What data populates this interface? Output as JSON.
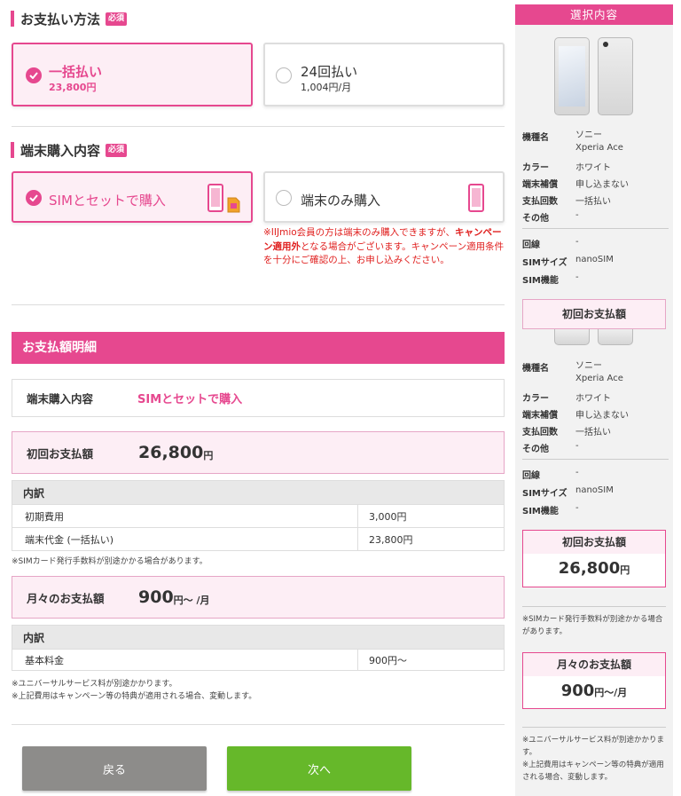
{
  "payment": {
    "title": "お支払い方法",
    "required": "必須",
    "options": [
      {
        "main": "一括払い",
        "sub": "23,800円",
        "selected": true
      },
      {
        "main": "24回払い",
        "sub": "1,004円/月",
        "selected": false
      }
    ]
  },
  "purchase": {
    "title": "端末購入内容",
    "required": "必須",
    "options": [
      {
        "main": "SIMとセットで購入",
        "selected": true
      },
      {
        "main": "端末のみ購入",
        "selected": false
      }
    ],
    "warning_before": "※IIJmio会員の方は端末のみ購入できますが、",
    "warning_bold": "キャンペーン適用外",
    "warning_after": "となる場合がございます。キャンペーン適用条件を十分にご確認の上、お申し込みください。"
  },
  "detail": {
    "header": "お支払額明細",
    "purchase_label": "端末購入内容",
    "purchase_value": "SIMとセットで購入",
    "initial_label": "初回お支払額",
    "initial_amount": "26,800",
    "yen": "円",
    "breakdown_label": "内訳",
    "initial_rows": [
      {
        "name": "初期費用",
        "value": "3,000円"
      },
      {
        "name": "端末代金 (一括払い)",
        "value": "23,800円"
      }
    ],
    "sim_note": "※SIMカード発行手数料が別途かかる場合があります。",
    "monthly_label": "月々のお支払額",
    "monthly_amount": "900",
    "monthly_unit": "円～ /月",
    "monthly_rows": [
      {
        "name": "基本料金",
        "value": "900円～"
      }
    ],
    "notes": [
      "※ユニバーサルサービス料が別途かかります。",
      "※上記費用はキャンペーン等の特典が適用される場合、変動します。"
    ]
  },
  "buttons": {
    "back": "戻る",
    "next": "次へ"
  },
  "sidebar": {
    "title": "選択内容",
    "spec1": [
      {
        "label": "機種名",
        "value": "ソニー",
        "value2": "Xperia Ace"
      },
      {
        "label": "カラー",
        "value": "ホワイト"
      },
      {
        "label": "端末補償",
        "value": "申し込まない"
      },
      {
        "label": "支払回数",
        "value": "一括払い"
      },
      {
        "label": "その他",
        "value": "-"
      }
    ],
    "spec1b": [
      {
        "label": "回線",
        "value": "-"
      },
      {
        "label": "SIMサイズ",
        "value": "nanoSIM"
      },
      {
        "label": "SIM機能",
        "value": "-"
      }
    ],
    "floating_label": "初回お支払額",
    "spec2": [
      {
        "label": "機種名",
        "value": "ソニー",
        "value2": "Xperia Ace"
      },
      {
        "label": "カラー",
        "value": "ホワイト"
      },
      {
        "label": "端末補償",
        "value": "申し込まない"
      },
      {
        "label": "支払回数",
        "value": "一括払い"
      },
      {
        "label": "その他",
        "value": "-"
      }
    ],
    "spec2b": [
      {
        "label": "回線",
        "value": "-"
      },
      {
        "label": "SIMサイズ",
        "value": "nanoSIM"
      },
      {
        "label": "SIM機能",
        "value": "-"
      }
    ],
    "initial_label": "初回お支払額",
    "initial_amount": "26,800",
    "yen": "円",
    "sim_note": "※SIMカード発行手数料が別途かかる場合があります。",
    "monthly_label": "月々のお支払額",
    "monthly_amount": "900",
    "monthly_unit": "円～/月",
    "notes": [
      "※ユニバーサルサービス料が別途かかります。",
      "※上記費用はキャンペーン等の特典が適用される場合、変動します。"
    ]
  },
  "colors": {
    "accent": "#e6488f",
    "next": "#66b82a",
    "back": "#8d8c8a"
  }
}
